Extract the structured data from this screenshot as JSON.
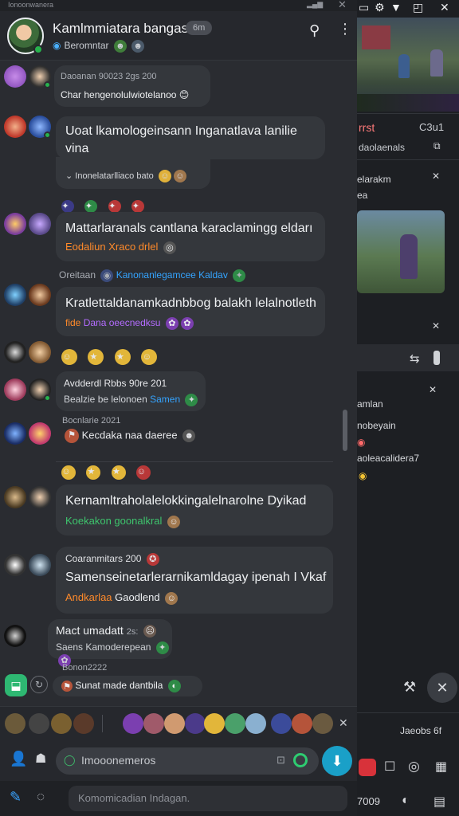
{
  "statusbar": {
    "text": "Ionoonwanera",
    "close": "✕"
  },
  "header": {
    "title": "Kamlmmiatara bangasai",
    "badge": "6m",
    "subtitle": "Beromntar"
  },
  "messages": [
    {
      "meta": "Daoanan 90023 2gs 200",
      "text": "Char hengenolulwiotelanoo",
      "emoji": "😊"
    },
    {
      "text": "Uoat lkamologeinsann Inganatlava lanilie vina",
      "sub": "Inonelatarlliaco bato"
    },
    {
      "text": "Mattarlaranals cantlana karaclamingg eldarı",
      "sub": "Eodaliun Xraco drlel"
    },
    {
      "meta": "Oreitaan",
      "metaLink": "Kanonanlegamcee Kaldav"
    },
    {
      "text": "Kratlettaldanamkadnbbog balakh lelalnotleth",
      "sub": "fide",
      "subColor": "Dana oeecnedksu"
    },
    {
      "meta": "Avdderdl Rbbs 90re 201",
      "sub": "Bealzie be lelonoen",
      "subLink": "Samen"
    },
    {
      "meta": "Bocnlarie 2021",
      "text": "Kecdaka naa daeree"
    },
    {
      "text": "Kernamltraholalelokkingalelnarolne Dyikad",
      "sub": "Koekakon goonalkral"
    },
    {
      "meta": "Coaranmitars 200",
      "text": "Samenseinetarlerarnikamldagay ipenah I Vkaf",
      "sub": "Andkarlaa",
      "subPlain": "Gaodlend"
    },
    {
      "text": "Mact umadatt",
      "meta": "2s:",
      "sub": "Saens Kamoderepean"
    },
    {
      "meta": "Bonon2222",
      "text": "Sunat made dantbila"
    }
  ],
  "composer": {
    "placeholder": "Imooonemeros",
    "footer_placeholder": "Komomicadian Indagan."
  },
  "right_panel": {
    "section1": "rrst",
    "section1_code": "C3u1",
    "section1_sub": "daolaenals",
    "item_a": "elarakm",
    "item_a2": "ea",
    "item_b": "amlan",
    "item_c": "nobeyain",
    "item_d": "aoleacalidera7",
    "footer_a": "Jaeobs 6f",
    "footer_b": "7009"
  },
  "icons": {
    "search": "search-icon",
    "menu": "kebab-menu-icon",
    "mic": "microphone-icon",
    "pen": "pen-icon"
  }
}
